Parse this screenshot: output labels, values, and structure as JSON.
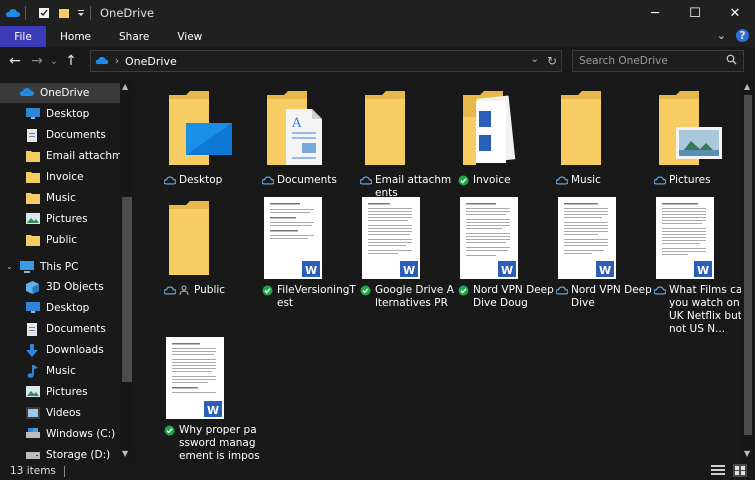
{
  "window": {
    "title": "OneDrive",
    "minimize_glyph": "─",
    "maximize_glyph": "☐",
    "close_glyph": "✕"
  },
  "ribbon": {
    "tabs": [
      "File",
      "Home",
      "Share",
      "View"
    ],
    "expand_glyph": "⌄",
    "help_glyph": "?"
  },
  "nav": {
    "back_glyph": "←",
    "forward_glyph": "→",
    "recent_glyph": "⌄",
    "up_glyph": "↑"
  },
  "address": {
    "path": "OneDrive",
    "separator": "›",
    "dropdown_glyph": "⌄",
    "refresh_glyph": "↻"
  },
  "search": {
    "placeholder": "Search OneDrive",
    "icon_glyph": "⚲"
  },
  "sidebar": {
    "items": [
      {
        "label": "OneDrive",
        "icon": "onedrive-icon",
        "selected": true
      },
      {
        "label": "Desktop",
        "icon": "desktop-icon"
      },
      {
        "label": "Documents",
        "icon": "documents-icon"
      },
      {
        "label": "Email attachmer",
        "icon": "folder-icon"
      },
      {
        "label": "Invoice",
        "icon": "folder-icon"
      },
      {
        "label": "Music",
        "icon": "folder-icon"
      },
      {
        "label": "Pictures",
        "icon": "pictures-icon"
      },
      {
        "label": "Public",
        "icon": "folder-icon"
      },
      {
        "label": "This PC",
        "icon": "pc-icon"
      },
      {
        "label": "3D Objects",
        "icon": "3d-objects-icon"
      },
      {
        "label": "Desktop",
        "icon": "desktop-icon"
      },
      {
        "label": "Documents",
        "icon": "documents-icon"
      },
      {
        "label": "Downloads",
        "icon": "downloads-icon"
      },
      {
        "label": "Music",
        "icon": "music-icon"
      },
      {
        "label": "Pictures",
        "icon": "pictures-icon"
      },
      {
        "label": "Videos",
        "icon": "videos-icon"
      },
      {
        "label": "Windows (C:)",
        "icon": "drive-c-icon"
      },
      {
        "label": "Storage  (D:)",
        "icon": "drive-d-icon"
      }
    ],
    "scroll_up_glyph": "▲",
    "scroll_down_glyph": "▼"
  },
  "files": [
    {
      "name": "Desktop",
      "kind": "folder-desktop",
      "status": "cloud"
    },
    {
      "name": "Documents",
      "kind": "folder-documents",
      "status": "cloud"
    },
    {
      "name": "Email attachments",
      "kind": "folder",
      "status": "cloud"
    },
    {
      "name": "Invoice",
      "kind": "folder-invoice",
      "status": "synced"
    },
    {
      "name": "Music",
      "kind": "folder",
      "status": "cloud"
    },
    {
      "name": "Pictures",
      "kind": "folder-pictures",
      "status": "cloud"
    },
    {
      "name": "Public",
      "kind": "folder",
      "status": "cloud-shared"
    },
    {
      "name": "FileVersioningTest",
      "kind": "word-doc",
      "status": "synced"
    },
    {
      "name": "Google Drive Alternatives PR",
      "kind": "word-doc",
      "status": "synced"
    },
    {
      "name": "Nord VPN Deep Dive Doug",
      "kind": "word-doc",
      "status": "synced"
    },
    {
      "name": "Nord VPN Deep Dive",
      "kind": "word-doc",
      "status": "cloud"
    },
    {
      "name": "What Films can you watch on UK Netflix but not US N...",
      "kind": "word-doc",
      "status": "cloud"
    },
    {
      "name": "Why proper password management is imposs...",
      "kind": "word-doc",
      "status": "synced"
    }
  ],
  "status": {
    "item_count": "13 items"
  },
  "colors": {
    "accent": "#3b3bb8",
    "folder": "#f5cd63",
    "onedrive_blue": "#1f8be6",
    "synced_green": "#1fa84a",
    "word_blue": "#2b5eb8"
  }
}
